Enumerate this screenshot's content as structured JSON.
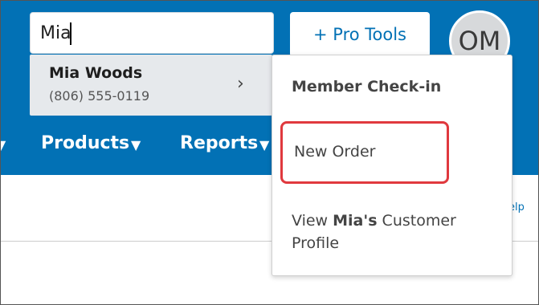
{
  "search": {
    "value": "Mia"
  },
  "header": {
    "pro_tools_label": "+ Pro Tools",
    "avatar_initials": "OM"
  },
  "search_results": [
    {
      "name": "Mia Woods",
      "phone": "(806) 555-0119"
    }
  ],
  "nav": {
    "items": [
      {
        "label": "Products",
        "caret": "▼"
      },
      {
        "label": "Reports",
        "caret": "▼"
      }
    ],
    "left_caret": "▼"
  },
  "subbar": {
    "help_fragment": "elp"
  },
  "dropdown": {
    "header": "Member Check-in",
    "new_order": "New Order",
    "view_profile": {
      "prefix": "View ",
      "name": "Mia's",
      "suffix": " Customer Profile"
    },
    "highlight_color": "#e0393e"
  },
  "colors": {
    "brand_blue": "#0271b5"
  }
}
